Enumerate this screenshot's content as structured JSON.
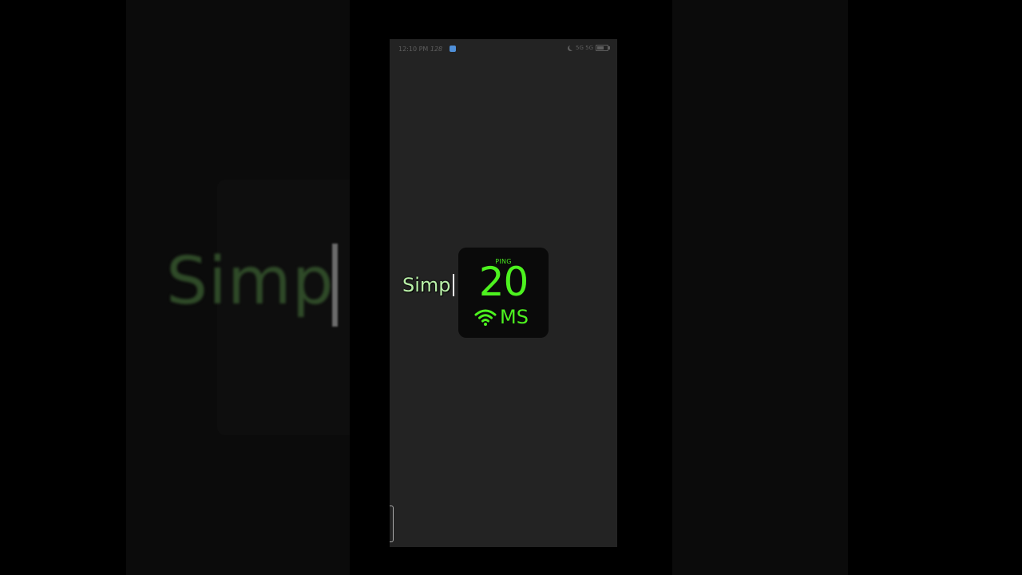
{
  "status_bar": {
    "time": "12:10 PM",
    "extra": "128",
    "signal": "5G 5G"
  },
  "ghost": {
    "text": "Simp"
  },
  "editor": {
    "typed_text": "Simp"
  },
  "widget": {
    "label": "PING",
    "value": "20",
    "unit": "MS",
    "accent_color": "#4df21f",
    "icon": "wifi-icon"
  },
  "battery": {
    "level": 0.7
  }
}
